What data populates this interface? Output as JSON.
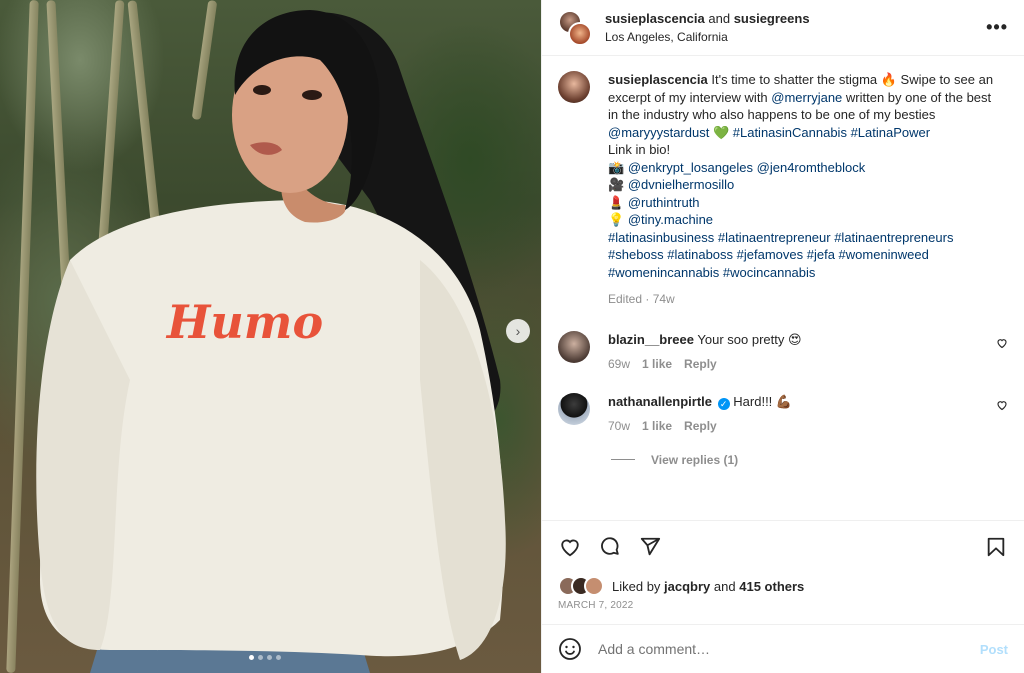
{
  "header": {
    "user1": "susieplascencia",
    "and": "and",
    "user2": "susiegreens",
    "location": "Los Angeles, California",
    "more": "•••"
  },
  "photo": {
    "print_text": "Humo",
    "slide_count": 4,
    "active_slide": 1
  },
  "caption": {
    "username": "susieplascencia",
    "lines": {
      "p1_a": "It's time to shatter the stigma 🔥 Swipe to see an excerpt of my interview with ",
      "p1_link1": "@merryjane",
      "p1_b": " written by one of the best in the industry who also happens to be one of my besties ",
      "p1_link2": "@maryyystardust",
      "p1_c": " 💚 ",
      "p1_tag1": "#LatinasinCannabis",
      "p1_d": " ",
      "p1_tag2": "#LatinaPower",
      "p2": "Link in bio!",
      "credit1_emoji": "📸",
      "credit1_a": "@enkrypt_losangeles",
      "credit1_b": "@jen4romtheblock",
      "credit2_emoji": "🎥",
      "credit2": "@dvnielhermosillo",
      "credit3_emoji": "💄",
      "credit3": "@ruthintruth",
      "credit4_emoji": "💡",
      "credit4": "@tiny.machine",
      "tags": "#latinasinbusiness #latinaentrepreneur #latinaentrepreneurs #sheboss #latinaboss #jefamoves #jefa #womeninweed #womenincannabis #wocincannabis"
    },
    "meta": "Edited · 74w"
  },
  "comments": [
    {
      "username": "blazin__breee",
      "text": "Your soo pretty 😍",
      "age": "69w",
      "likes": "1 like",
      "reply": "Reply"
    },
    {
      "username": "nathanallenpirtle",
      "text": "Hard!!! 💪🏾",
      "age": "70w",
      "likes": "1 like",
      "reply": "Reply",
      "verified": "✓"
    }
  ],
  "view_replies": "View replies (1)",
  "likes": {
    "prefix": "Liked by",
    "user": "jacqbry",
    "and": "and",
    "others": "415 others"
  },
  "date": "MARCH 7, 2022",
  "add_comment": {
    "placeholder": "Add a comment…",
    "post": "Post"
  },
  "icons": {
    "like": "heart-icon",
    "comment": "comment-icon",
    "share": "paper-plane-icon",
    "save": "bookmark-icon",
    "emoji": "smiley-icon",
    "next": "chevron-right-icon"
  }
}
